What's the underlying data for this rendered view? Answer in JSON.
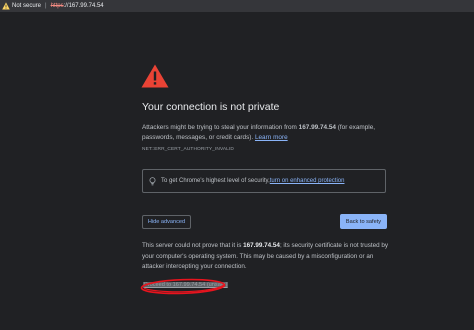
{
  "address_bar": {
    "security_label": "Not secure",
    "separator": "|",
    "url_scheme": "https",
    "url_rest": "://167.99.74.54"
  },
  "interstitial": {
    "title": "Your connection is not private",
    "description_prefix": "Attackers might be trying to steal your information from ",
    "description_host": "167.99.74.54",
    "description_suffix": " (for example, passwords, messages, or credit cards). ",
    "learn_more": "Learn more",
    "error_code": "NET::ERR_CERT_AUTHORITY_INVALID",
    "enhanced_prefix": "To get Chrome's highest level of security, ",
    "enhanced_link": "turn on enhanced protection",
    "hide_advanced": "Hide advanced",
    "back_to_safety": "Back to safety",
    "details_prefix": "This server could not prove that it is ",
    "details_host": "167.99.74.54",
    "details_suffix": "; its security certificate is not trusted by your computer's operating system. This may be caused by a misconfiguration or an attacker intercepting your connection.",
    "proceed_link": "Proceed to 167.99.74.54 (unsafe)"
  },
  "colors": {
    "background": "#202124",
    "accent_blue": "#8ab4f8",
    "warning_red": "#ea4335",
    "annotation_red": "#e8141e"
  },
  "icons": {
    "address_warning": "warning-triangle-icon",
    "main_warning": "warning-triangle-icon",
    "enhanced_tip": "lightbulb-icon"
  }
}
